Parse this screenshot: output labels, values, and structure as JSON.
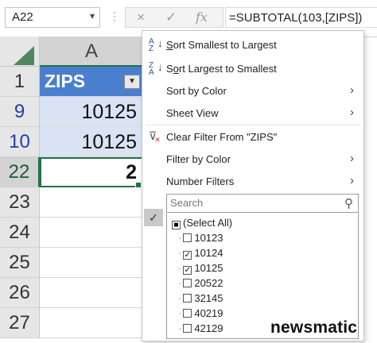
{
  "formula_bar": {
    "name_box": "A22",
    "cancel_icon": "×",
    "enter_icon": "✓",
    "fx_label": "fx",
    "formula": "=SUBTOTAL(103,[ZIPS])"
  },
  "grid": {
    "column_header": "A",
    "rows": [
      {
        "num": "1",
        "value": "ZIPS",
        "kind": "header"
      },
      {
        "num": "9",
        "value": "10125",
        "kind": "filtered"
      },
      {
        "num": "10",
        "value": "10125",
        "kind": "filtered"
      },
      {
        "num": "22",
        "value": "2",
        "kind": "active"
      },
      {
        "num": "23",
        "value": ""
      },
      {
        "num": "24",
        "value": ""
      },
      {
        "num": "25",
        "value": ""
      },
      {
        "num": "26",
        "value": ""
      },
      {
        "num": "27",
        "value": ""
      }
    ]
  },
  "menu": {
    "items": [
      {
        "icon": "sort-asc-icon",
        "label": "Sort Smallest to Largest",
        "u": "S"
      },
      {
        "icon": "sort-desc-icon",
        "label": "Sort Largest to Smallest",
        "u": "o"
      },
      {
        "label": "Sort by Color",
        "submenu": true
      },
      {
        "label": "Sheet View",
        "submenu": true
      },
      {
        "icon": "clear-filter-icon",
        "label": "Clear Filter From \"ZIPS\""
      },
      {
        "label": "Filter by Color",
        "submenu": true
      },
      {
        "label": "Number Filters",
        "submenu": true
      }
    ],
    "search_placeholder": "Search",
    "list": [
      {
        "label": "(Select All)",
        "state": "partial"
      },
      {
        "label": "10123",
        "state": "unchecked"
      },
      {
        "label": "10124",
        "state": "checked"
      },
      {
        "label": "10125",
        "state": "checked"
      },
      {
        "label": "20522",
        "state": "unchecked"
      },
      {
        "label": "32145",
        "state": "unchecked"
      },
      {
        "label": "40219",
        "state": "unchecked"
      },
      {
        "label": "42129",
        "state": "unchecked"
      }
    ]
  },
  "watermark": {
    "text": "newsmatic"
  },
  "colors": {
    "accent_green": "#217346",
    "header_blue": "#4a7fcf",
    "filtered_row_blue": "#dae3f3"
  }
}
